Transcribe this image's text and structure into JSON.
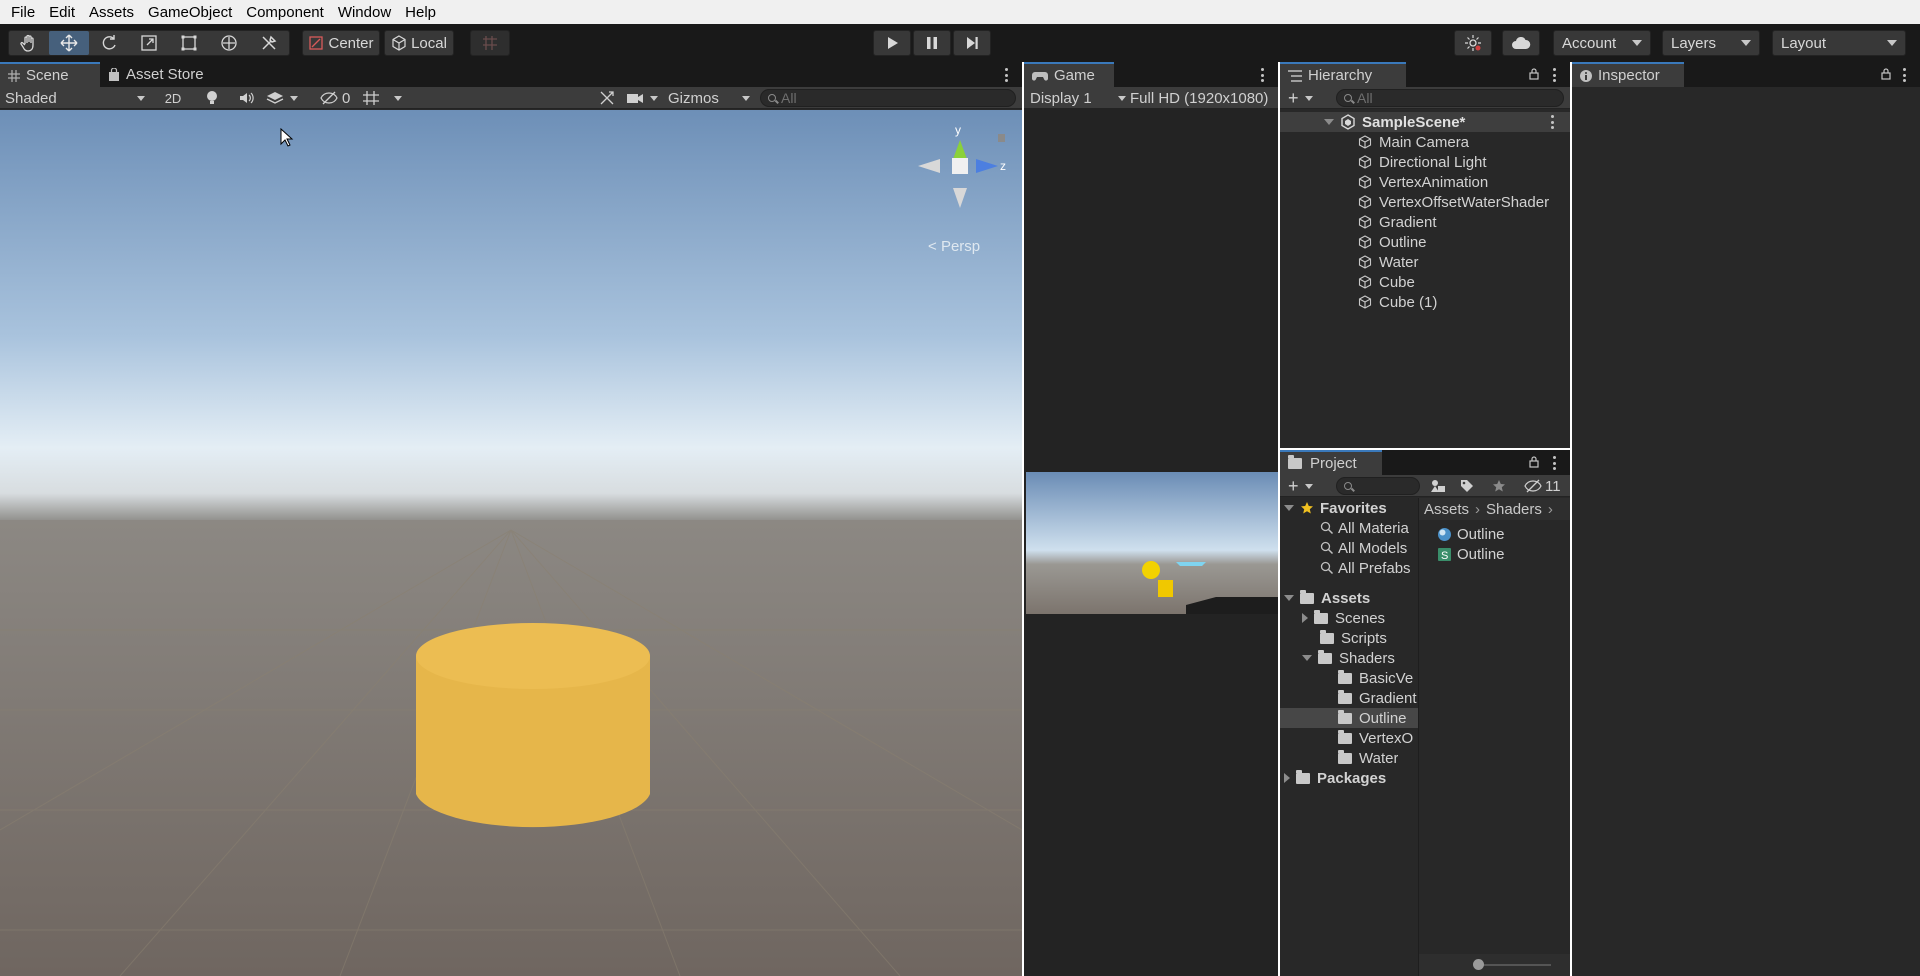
{
  "menu": [
    "File",
    "Edit",
    "Assets",
    "GameObject",
    "Component",
    "Window",
    "Help"
  ],
  "toolbar": {
    "center_label": "Center",
    "local_label": "Local",
    "account_label": "Account",
    "layers_label": "Layers",
    "layout_label": "Layout"
  },
  "scene": {
    "tab_label": "Scene",
    "asset_store_tab": "Asset Store",
    "shading_mode": "Shaded",
    "mode_2d": "2D",
    "hidden_count": "0",
    "gizmos_label": "Gizmos",
    "search_placeholder": "All",
    "projection_label": "Persp",
    "axis_y": "y",
    "axis_z": "z"
  },
  "game": {
    "tab_label": "Game",
    "display": "Display 1",
    "resolution": "Full HD (1920x1080)"
  },
  "hierarchy": {
    "tab_label": "Hierarchy",
    "search_placeholder": "All",
    "scene_name": "SampleScene*",
    "items": [
      "Main Camera",
      "Directional Light",
      "VertexAnimation",
      "VertexOffsetWaterShader",
      "Gradient",
      "Outline",
      "Water",
      "Cube",
      "Cube (1)"
    ]
  },
  "project": {
    "tab_label": "Project",
    "hidden_count": "11",
    "favorites_label": "Favorites",
    "favorites": [
      "All Materia",
      "All Models",
      "All Prefabs"
    ],
    "assets_label": "Assets",
    "asset_folders": [
      "Scenes",
      "Scripts",
      "Shaders"
    ],
    "shader_folders": [
      "BasicVe",
      "Gradient",
      "Outline",
      "VertexO",
      "Water"
    ],
    "packages_label": "Packages",
    "breadcrumb": [
      "Assets",
      "Shaders"
    ],
    "files": [
      "Outline",
      "Outline"
    ]
  },
  "inspector": {
    "tab_label": "Inspector"
  },
  "colors": {
    "panel_bg": "#282828",
    "tab_bar": "#191919",
    "accent_blue": "#3a79bb",
    "cylinder": "#e9b94a"
  }
}
